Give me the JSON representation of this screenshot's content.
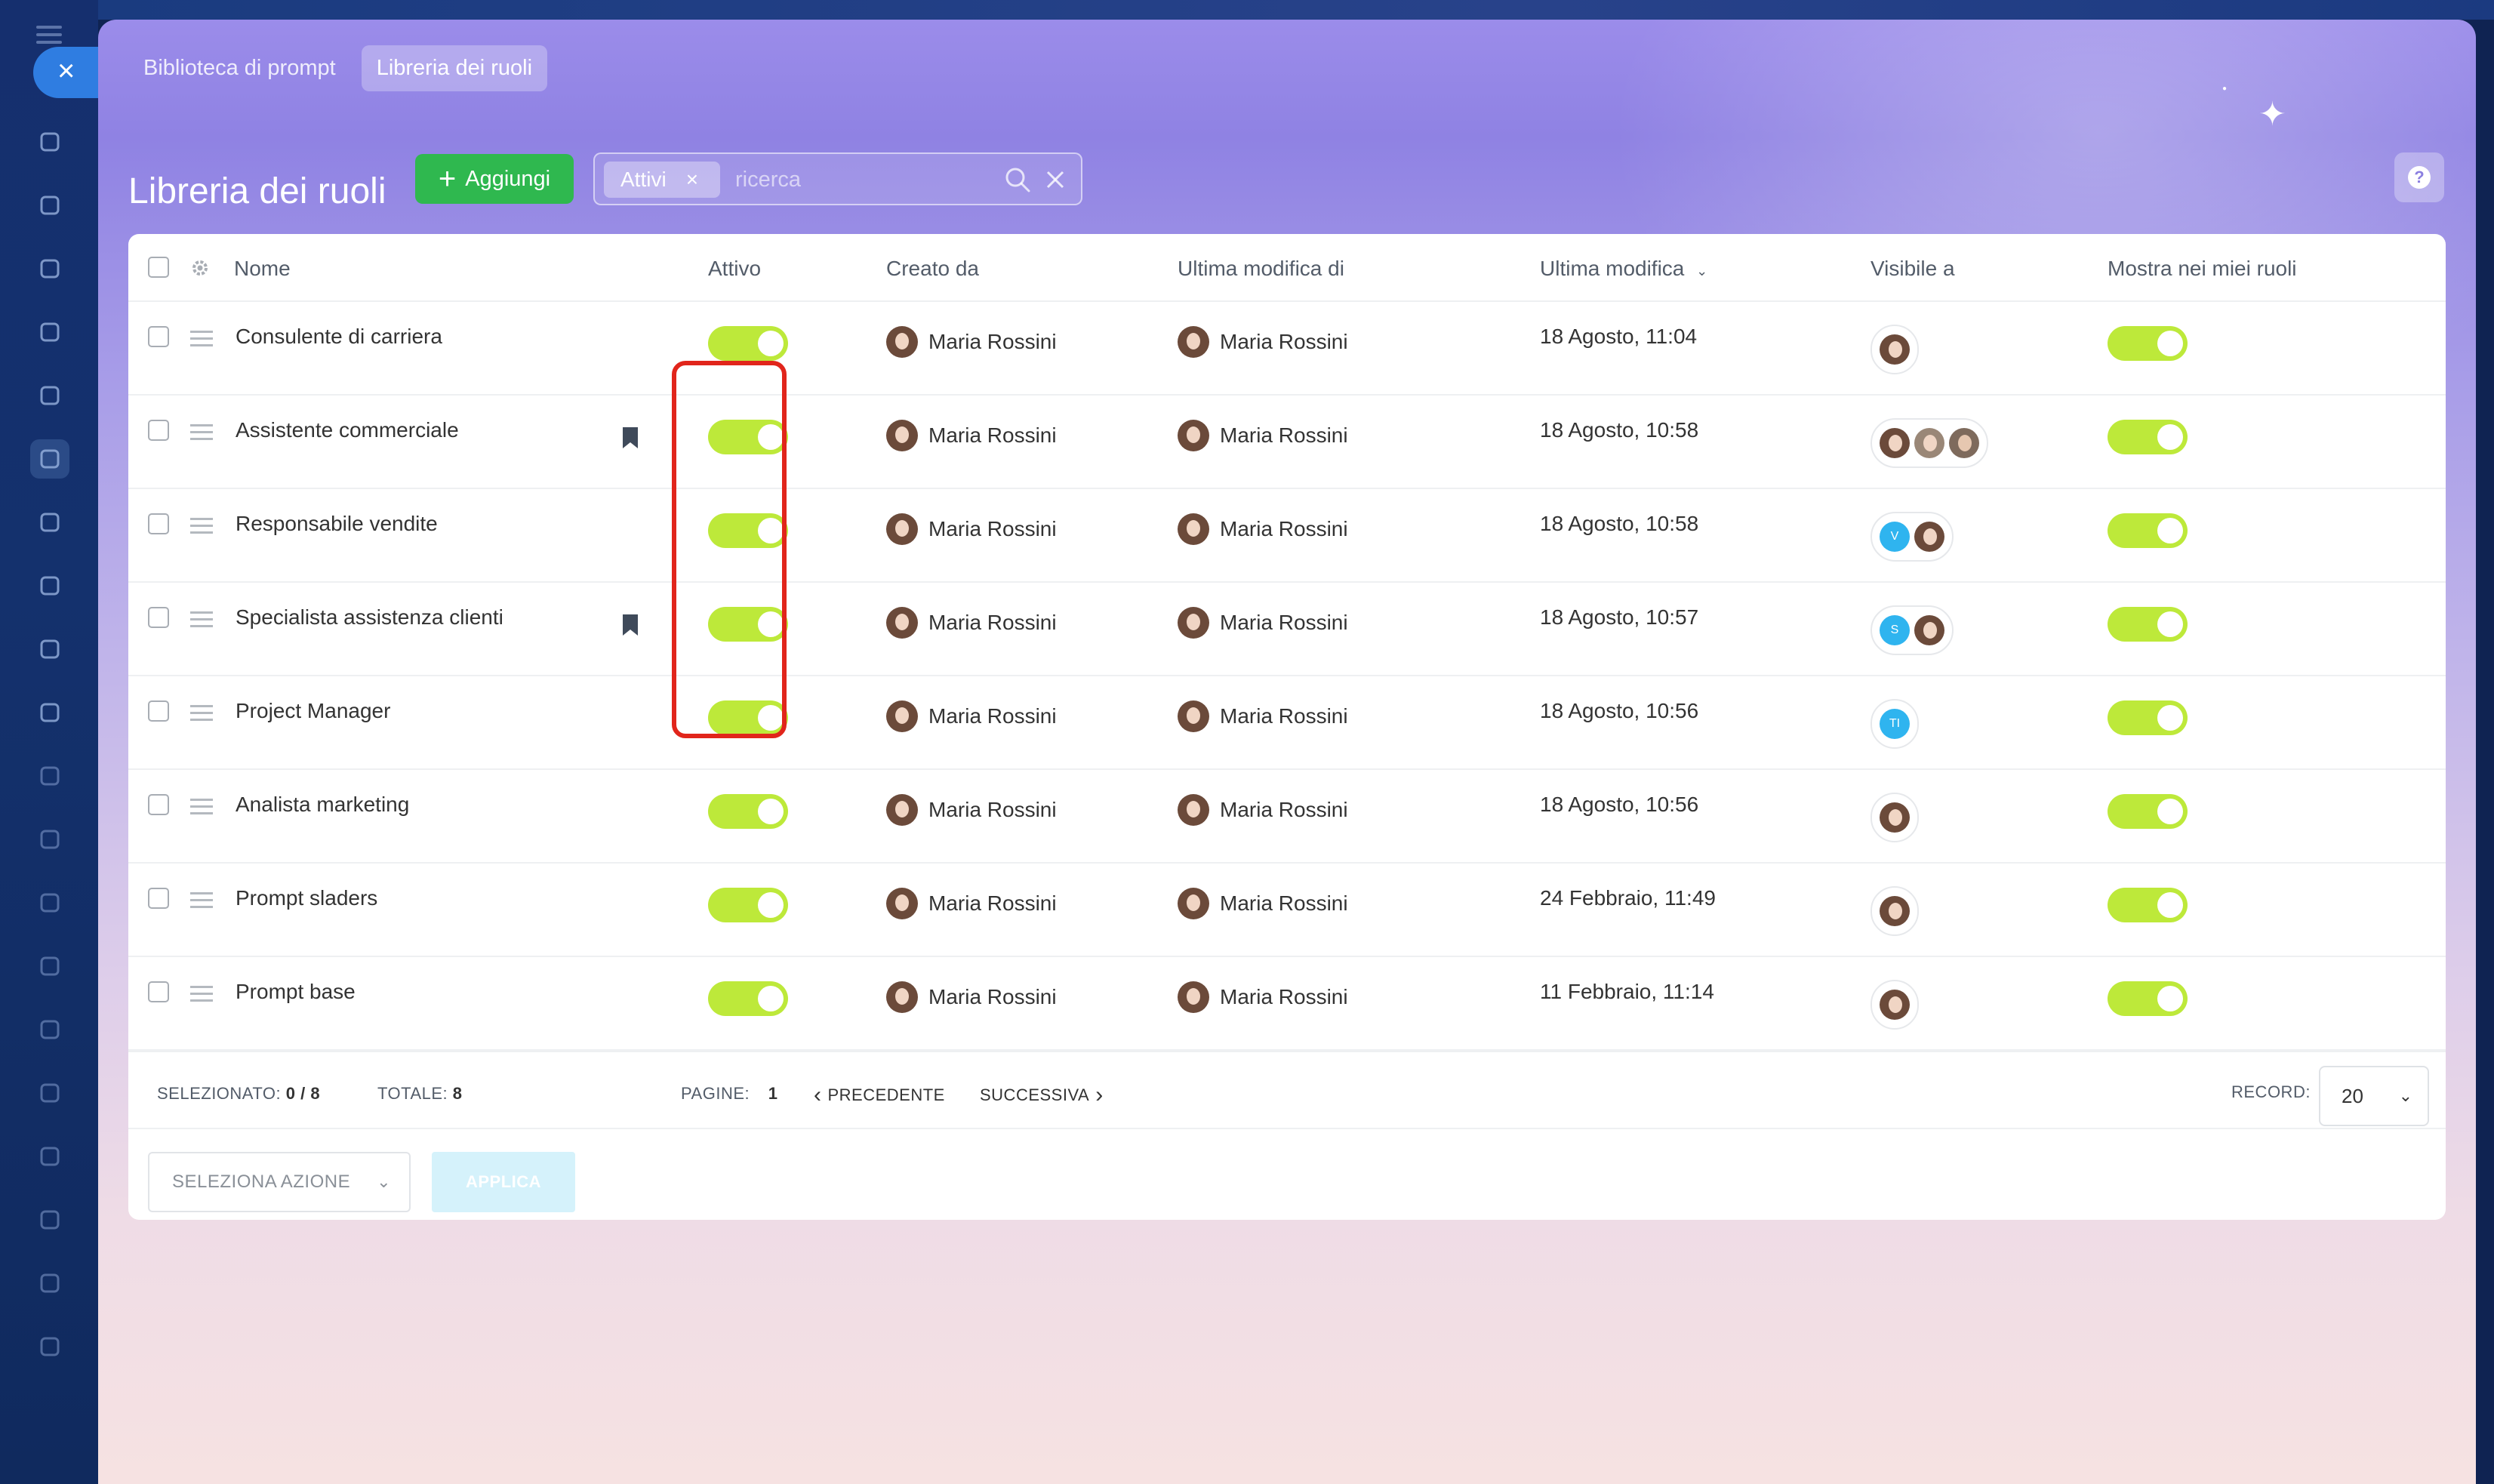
{
  "breadcrumbs": [
    "Biblioteca di prompt",
    "Libreria dei ruoli"
  ],
  "header": {
    "title": "Libreria dei ruoli",
    "add_label": "Aggiungi",
    "filter_chip": "Attivi",
    "search_placeholder": "ricerca",
    "help": "?"
  },
  "columns": {
    "name": "Nome",
    "active": "Attivo",
    "created_by": "Creato da",
    "modified_by": "Ultima modifica di",
    "modified": "Ultima modifica",
    "visible_to": "Visibile a",
    "show_in_roles": "Mostra nei miei ruoli"
  },
  "rows": [
    {
      "name": "Consulente di carriera",
      "bookmarked": false,
      "active": true,
      "created_by": "Maria Rossini",
      "modified_by": "Maria Rossini",
      "modified": "18 Agosto, 11:04",
      "visible": [
        "avatar"
      ],
      "show": true
    },
    {
      "name": "Assistente commerciale",
      "bookmarked": true,
      "active": true,
      "created_by": "Maria Rossini",
      "modified_by": "Maria Rossini",
      "modified": "18 Agosto, 10:58",
      "visible": [
        "avatar",
        "avatar",
        "avatar"
      ],
      "show": true
    },
    {
      "name": "Responsabile vendite",
      "bookmarked": false,
      "active": true,
      "created_by": "Maria Rossini",
      "modified_by": "Maria Rossini",
      "modified": "18 Agosto, 10:58",
      "visible": [
        "V",
        "avatar"
      ],
      "show": true
    },
    {
      "name": "Specialista assistenza clienti",
      "bookmarked": true,
      "active": true,
      "created_by": "Maria Rossini",
      "modified_by": "Maria Rossini",
      "modified": "18 Agosto, 10:57",
      "visible": [
        "S",
        "avatar"
      ],
      "show": true
    },
    {
      "name": "Project Manager",
      "bookmarked": false,
      "active": true,
      "created_by": "Maria Rossini",
      "modified_by": "Maria Rossini",
      "modified": "18 Agosto, 10:56",
      "visible": [
        "TI"
      ],
      "show": true
    },
    {
      "name": "Analista marketing",
      "bookmarked": false,
      "active": true,
      "created_by": "Maria Rossini",
      "modified_by": "Maria Rossini",
      "modified": "18 Agosto, 10:56",
      "visible": [
        "avatar"
      ],
      "show": true
    },
    {
      "name": "Prompt sladers",
      "bookmarked": false,
      "active": true,
      "created_by": "Maria Rossini",
      "modified_by": "Maria Rossini",
      "modified": "24 Febbraio, 11:49",
      "visible": [
        "avatar"
      ],
      "show": true
    },
    {
      "name": "Prompt base",
      "bookmarked": false,
      "active": true,
      "created_by": "Maria Rossini",
      "modified_by": "Maria Rossini",
      "modified": "11 Febbraio, 11:14",
      "visible": [
        "avatar"
      ],
      "show": true
    }
  ],
  "footer": {
    "selected_label": "SELEZIONATO:",
    "selected_value": "0 / 8",
    "total_label": "TOTALE:",
    "total_value": "8",
    "pages_label": "PAGINE:",
    "pages_value": "1",
    "prev": "PRECEDENTE",
    "next": "SUCCESSIVA",
    "record_label": "RECORD:",
    "record_value": "20",
    "action_select": "SELEZIONA AZIONE",
    "apply": "APPLICA"
  },
  "colors": {
    "add_button": "#2fb84f",
    "toggle_on": "#bde93a",
    "highlight": "#e1251b",
    "initials": "#2fb4ef"
  }
}
